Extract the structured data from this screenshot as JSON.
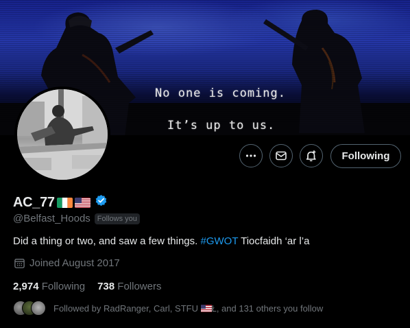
{
  "banner": {
    "quote_line_1": "No one is coming.",
    "quote_line_2": "It’s up to us."
  },
  "actions": {
    "more_icon": "more-horizontal-icon",
    "message_icon": "envelope-icon",
    "notify_icon": "bell-plus-icon",
    "following_label": "Following"
  },
  "profile": {
    "display_name": "AC_77",
    "name_flags": [
      "ireland-flag",
      "usa-flag"
    ],
    "verified_color": "#1d9bf0",
    "handle": "@Belfast_Hoods",
    "follows_you": "Follows you",
    "bio_before": "Did a thing or two, and saw a few things. ",
    "bio_hashtag": "#GWOT",
    "bio_after": " Tiocfaidh ‘ar l’a",
    "joined_icon": "calendar-icon",
    "joined": "Joined August 2017",
    "following_count": "2,974",
    "following_label": "Following",
    "followers_count": "738",
    "followers_label": "Followers",
    "followed_by_before": "Followed by RadRanger, Carl, STFU ",
    "followed_by_after": "Ł, and 131 others you follow"
  },
  "colors": {
    "background": "#000000",
    "text_primary": "#e7e9ea",
    "text_secondary": "#71767b",
    "accent": "#1d9bf0",
    "border": "#536471"
  }
}
